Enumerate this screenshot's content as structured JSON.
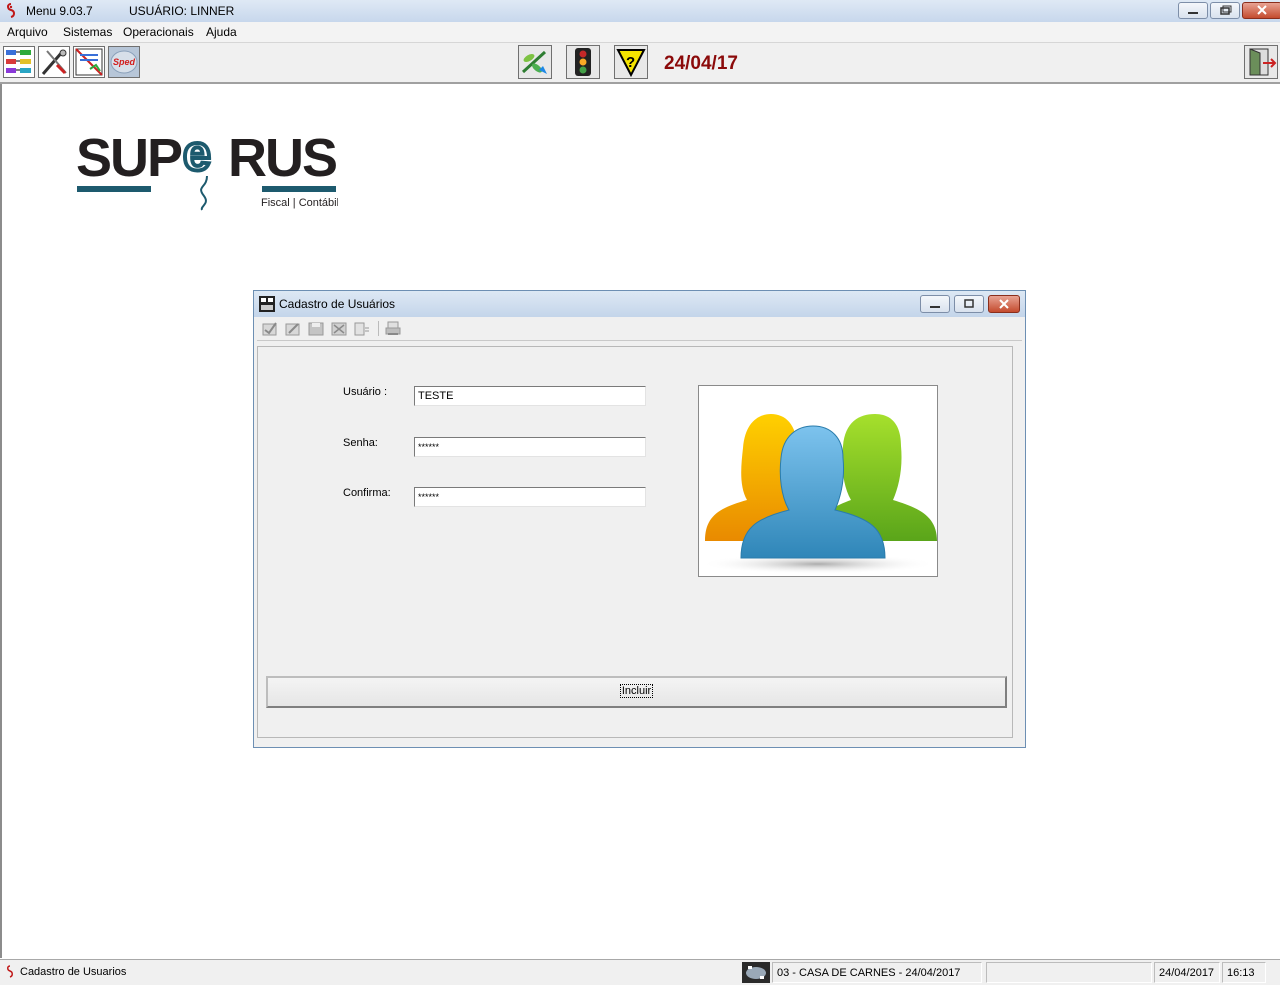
{
  "window": {
    "title": "Menu  9.03.7",
    "user": "USUÁRIO: LINNER"
  },
  "menu": [
    "Arquivo",
    "Sistemas",
    "Operacionais",
    "Ajuda"
  ],
  "toolbar": {
    "date": "24/04/17",
    "left_icons": [
      "organization-chart-icon",
      "tools-icon",
      "report-icon",
      "sped-icon"
    ],
    "center_icons": [
      "plant-arrow-icon",
      "traffic-light-icon",
      "help-question-icon"
    ],
    "right_icons": [
      "exit-door-icon"
    ],
    "sped_label": "Sped"
  },
  "logo": {
    "text": "SUPeRUS",
    "tagline": "Fiscal | Contábil",
    "color_dark": "#231f20",
    "color_accent": "#1d5a6e"
  },
  "dialog": {
    "title": "Cadastro de Usuários",
    "toolbar_icons": [
      "confirm-icon",
      "edit-icon",
      "save-icon",
      "delete-icon",
      "list-icon",
      "print-icon"
    ],
    "fields": {
      "usuario_label": "Usuário :",
      "usuario_value": "TESTE",
      "senha_label": "Senha:",
      "senha_value": "******",
      "confirma_label": "Confirma:",
      "confirma_value": "******"
    },
    "image": "users-group-icon",
    "button_label": "Incluir"
  },
  "statusbar": {
    "form": "Cadastro de Usuarios",
    "company": "03 - CASA DE CARNES - 24/04/2017",
    "empty": "",
    "date": "24/04/2017",
    "time": "16:13"
  }
}
